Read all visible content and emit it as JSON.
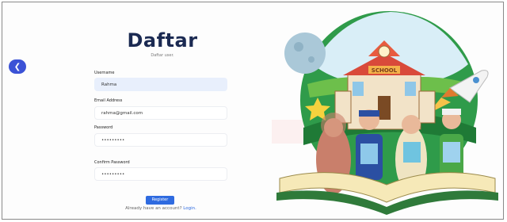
{
  "page": {
    "title": "Daftar",
    "subtitle": "Daftar user."
  },
  "form": {
    "username_label": "Username",
    "username_value": "Rahma",
    "email_label": "Email Address",
    "email_value": "rahma@gmail.com",
    "password_label": "Password",
    "password_value": "•••••••••",
    "confirm_label": "Confirm Password",
    "confirm_value": "•••••••••",
    "register_label": "Register",
    "account_prompt": "Already have an account?",
    "login_label": "Login."
  },
  "illustration": {
    "school_sign": "SCHOOL"
  },
  "icons": {
    "back": "chevron-left-icon"
  },
  "colors": {
    "accent": "#2f6be0",
    "back_button": "#3b52d6",
    "title": "#1b2a52",
    "filled_field": "#e8effc"
  }
}
